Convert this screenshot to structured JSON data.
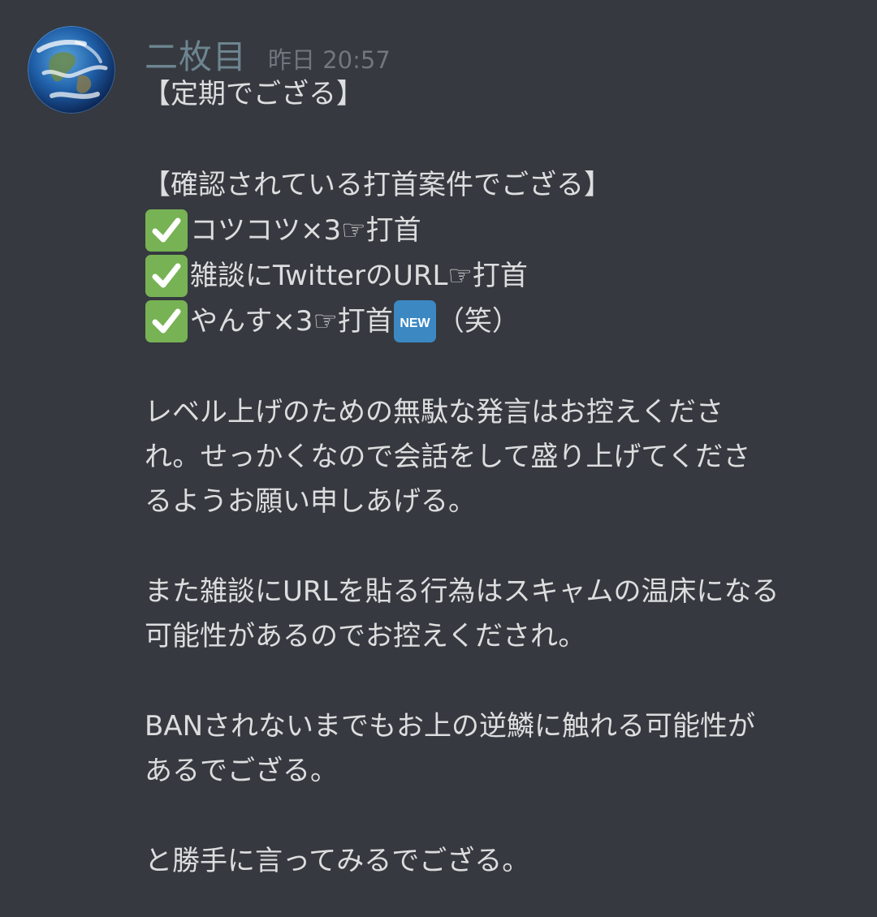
{
  "message": {
    "author": "二枚目",
    "timestamp": "昨日 20:57",
    "lines": {
      "l1": "【定期でござる】",
      "l2": "【確認されている打首案件でござる】",
      "item1": "コツコツ×3☞打首",
      "item2": "雑談にTwitterのURL☞打首",
      "item3_a": "やんす×3☞打首",
      "item3_b": "（笑）",
      "p1_1": "レベル上げのための無駄な発言はお控えくださ",
      "p1_2": "れ。せっかくなので会話をして盛り上げてくださ",
      "p1_3": "るようお願い申しあげる。",
      "p2_1": "また雑談にURLを貼る行為はスキャムの温床になる",
      "p2_2": "可能性があるのでお控えくだされ。",
      "p3_1": "BANされないまでもお上の逆鱗に触れる可能性が",
      "p3_2": "あるでござる。",
      "p4_1": "と勝手に言ってみるでござる。"
    },
    "badge_new": "NEW"
  },
  "icons": {
    "avatar": "earth-globe-avatar",
    "check": "white-check-mark-icon",
    "new": "new-badge-icon"
  },
  "colors": {
    "background": "#36393f",
    "text": "#dcddde",
    "username": "#6d8590",
    "timestamp": "#72767d",
    "check_green": "#77b255",
    "new_blue": "#3b88c3"
  }
}
